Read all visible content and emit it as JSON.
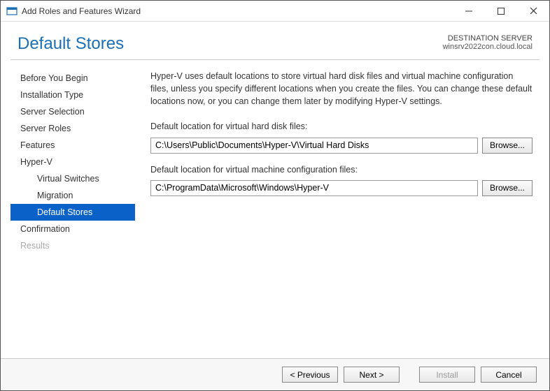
{
  "window": {
    "title": "Add Roles and Features Wizard"
  },
  "header": {
    "page_title": "Default Stores",
    "dest_label": "DESTINATION SERVER",
    "dest_name": "winsrv2022con.cloud.local"
  },
  "sidebar": {
    "items": [
      {
        "label": "Before You Begin"
      },
      {
        "label": "Installation Type"
      },
      {
        "label": "Server Selection"
      },
      {
        "label": "Server Roles"
      },
      {
        "label": "Features"
      },
      {
        "label": "Hyper-V"
      },
      {
        "label": "Virtual Switches"
      },
      {
        "label": "Migration"
      },
      {
        "label": "Default Stores"
      },
      {
        "label": "Confirmation"
      },
      {
        "label": "Results"
      }
    ]
  },
  "main": {
    "description": "Hyper-V uses default locations to store virtual hard disk files and virtual machine configuration files, unless you specify different locations when you create the files. You can change these default locations now, or you can change them later by modifying Hyper-V settings.",
    "vhd_label": "Default location for virtual hard disk files:",
    "vhd_value": "C:\\Users\\Public\\Documents\\Hyper-V\\Virtual Hard Disks",
    "vm_label": "Default location for virtual machine configuration files:",
    "vm_value": "C:\\ProgramData\\Microsoft\\Windows\\Hyper-V",
    "browse": "Browse..."
  },
  "footer": {
    "previous": "< Previous",
    "next": "Next >",
    "install": "Install",
    "cancel": "Cancel"
  }
}
